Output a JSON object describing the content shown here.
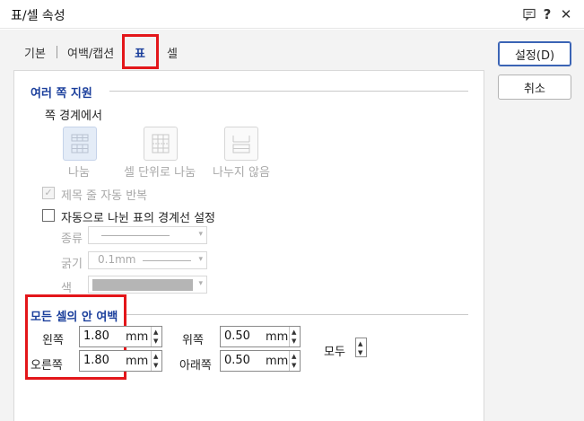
{
  "window": {
    "title": "표/셀 속성"
  },
  "titlebar_icons": [
    "chat-icon",
    "help-icon",
    "close-icon"
  ],
  "titlebar_glyphs": {
    "help": "?",
    "close": "✕"
  },
  "tabs": [
    {
      "label": "기본"
    },
    {
      "label": "여백/캡션"
    },
    {
      "label": "표",
      "active": true
    },
    {
      "label": "셀"
    }
  ],
  "buttons": {
    "ok": "설정(D)",
    "cancel": "취소"
  },
  "multi_page": {
    "title": "여러 쪽 지원",
    "page_border_label": "쪽 경계에서",
    "options": [
      {
        "label": "나눔",
        "selected": true
      },
      {
        "label": "셀 단위로 나눔"
      },
      {
        "label": "나누지 않음"
      }
    ],
    "repeat_header": {
      "label": "제목 줄 자동 반복",
      "checked": true,
      "disabled": true
    },
    "border_setting": {
      "label": "자동으로 나뉜 표의 경계선 설정",
      "checked": false
    },
    "line_type_label": "종류",
    "line_width_label": "굵기",
    "line_width_value": "0.1mm",
    "color_label": "색",
    "color_value": "#b5b5b5"
  },
  "cell_margins": {
    "title": "모든 셀의 안 여백",
    "left": {
      "label": "왼쪽",
      "value": "1.80",
      "unit": "mm"
    },
    "right": {
      "label": "오른쪽",
      "value": "1.80",
      "unit": "mm"
    },
    "top": {
      "label": "위쪽",
      "value": "0.50",
      "unit": "mm"
    },
    "bottom": {
      "label": "아래쪽",
      "value": "0.50",
      "unit": "mm"
    },
    "all_label": "모두"
  },
  "colors": {
    "accent": "#1b3f9c",
    "highlight": "#e3161a"
  }
}
